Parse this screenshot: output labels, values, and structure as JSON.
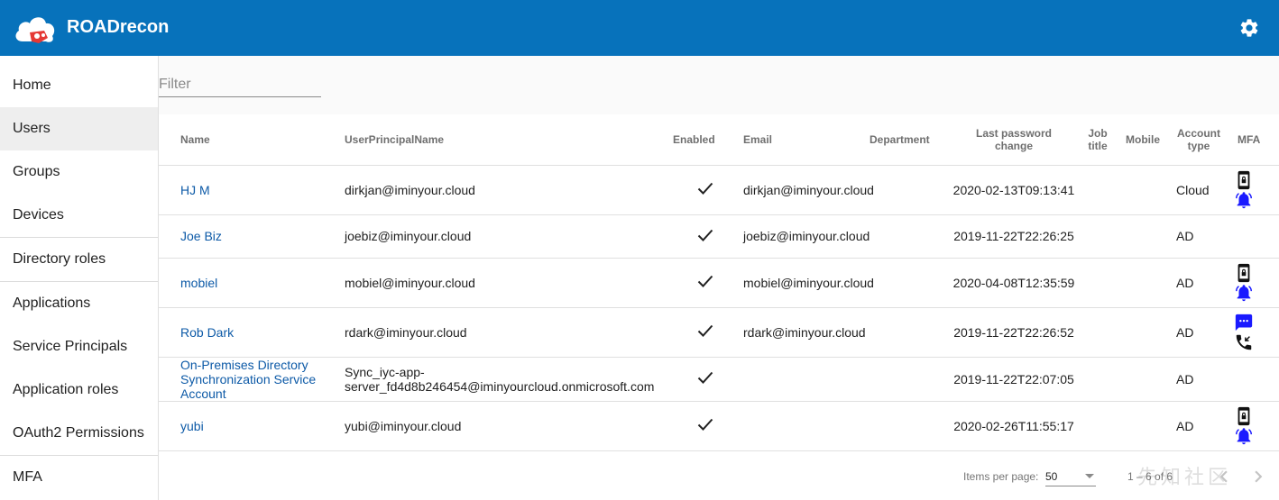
{
  "app": {
    "title": "ROADrecon"
  },
  "sidebar": {
    "items": [
      {
        "label": "Home"
      },
      {
        "label": "Users"
      },
      {
        "label": "Groups"
      },
      {
        "label": "Devices"
      },
      {
        "label": "Directory roles"
      },
      {
        "label": "Applications"
      },
      {
        "label": "Service Principals"
      },
      {
        "label": "Application roles"
      },
      {
        "label": "OAuth2 Permissions"
      },
      {
        "label": "MFA"
      }
    ],
    "active": "Users"
  },
  "filter": {
    "placeholder": "Filter",
    "value": ""
  },
  "table": {
    "headers": {
      "name": "Name",
      "upn": "UserPrincipalName",
      "enabled": "Enabled",
      "email": "Email",
      "department": "Department",
      "lastpw_1": "Last password",
      "lastpw_2": "change",
      "job_1": "Job",
      "job_2": "title",
      "mobile": "Mobile",
      "acct_1": "Account",
      "acct_2": "type",
      "mfa": "MFA"
    },
    "rows": [
      {
        "name": "HJ M",
        "upn": "dirkjan@iminyour.cloud",
        "enabled": true,
        "email": "dirkjan@iminyour.cloud",
        "department": "",
        "lastpw": "2020-02-13T09:13:41",
        "job": "",
        "mobile": "",
        "acct": "Cloud",
        "mfa": [
          "phone-lock-icon",
          "bell-ring-icon"
        ]
      },
      {
        "name": "Joe Biz",
        "upn": "joebiz@iminyour.cloud",
        "enabled": true,
        "email": "joebiz@iminyour.cloud",
        "department": "",
        "lastpw": "2019-11-22T22:26:25",
        "job": "",
        "mobile": "",
        "acct": "AD",
        "mfa": []
      },
      {
        "name": "mobiel",
        "upn": "mobiel@iminyour.cloud",
        "enabled": true,
        "email": "mobiel@iminyour.cloud",
        "department": "",
        "lastpw": "2020-04-08T12:35:59",
        "job": "",
        "mobile": "",
        "acct": "AD",
        "mfa": [
          "phone-lock-icon",
          "bell-ring-icon"
        ]
      },
      {
        "name": "Rob Dark",
        "upn": "rdark@iminyour.cloud",
        "enabled": true,
        "email": "rdark@iminyour.cloud",
        "department": "",
        "lastpw": "2019-11-22T22:26:52",
        "job": "",
        "mobile": "",
        "acct": "AD",
        "mfa": [
          "sms-icon",
          "phone-callback-icon"
        ]
      },
      {
        "name": "On-Premises Directory Synchronization Service Account",
        "upn": "Sync_iyc-app-server_fd4d8b246454@iminyourcloud.onmicrosoft.com",
        "enabled": true,
        "email": "",
        "department": "",
        "lastpw": "2019-11-22T22:07:05",
        "job": "",
        "mobile": "",
        "acct": "AD",
        "mfa": []
      },
      {
        "name": "yubi",
        "upn": "yubi@iminyour.cloud",
        "enabled": true,
        "email": "",
        "department": "",
        "lastpw": "2020-02-26T11:55:17",
        "job": "",
        "mobile": "",
        "acct": "AD",
        "mfa": [
          "phone-lock-icon",
          "bell-ring-icon"
        ]
      }
    ]
  },
  "paginator": {
    "items_per_page_label": "Items per page:",
    "items_per_page": "50",
    "range": "1 – 6 of 6"
  },
  "watermark": "先知社区",
  "colors": {
    "header": "#0772bb",
    "link": "#0d5aa7",
    "mfa_blue": "#1a1aff"
  }
}
